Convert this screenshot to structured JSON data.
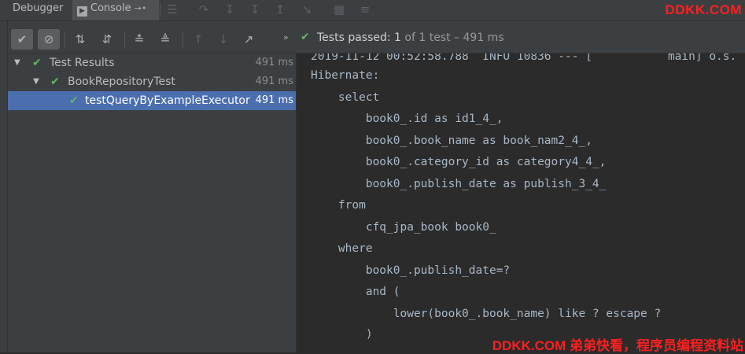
{
  "tabs": {
    "debugger_label": "Debugger",
    "console_label": "Console"
  },
  "watermark": {
    "top": "DDKK.COM",
    "bottom": "DDKK.COM 弟弟快看，程序员编程资料站"
  },
  "status": {
    "prefix": "Tests passed:",
    "count": "1",
    "suffix": "of 1 test – 491 ms"
  },
  "tree": {
    "items": [
      {
        "label": "Test Results",
        "time": "491 ms"
      },
      {
        "label": "BookRepositoryTest",
        "time": "491 ms"
      },
      {
        "label": "testQueryByExampleExecutor",
        "time": "491 ms"
      }
    ]
  },
  "console": {
    "lines": [
      "2019-11-12 00:52:58.788  INFO 10836 --- [           main] o.s.",
      "Hibernate:",
      "    select",
      "        book0_.id as id1_4_,",
      "        book0_.book_name as book_nam2_4_,",
      "        book0_.category_id as category4_4_,",
      "        book0_.publish_date as publish_3_4_",
      "    from",
      "        cfq_jpa_book book0_",
      "    where",
      "        book0_.publish_date=?",
      "        and (",
      "            lower(book0_.book_name) like ? escape ?",
      "        )"
    ]
  }
}
